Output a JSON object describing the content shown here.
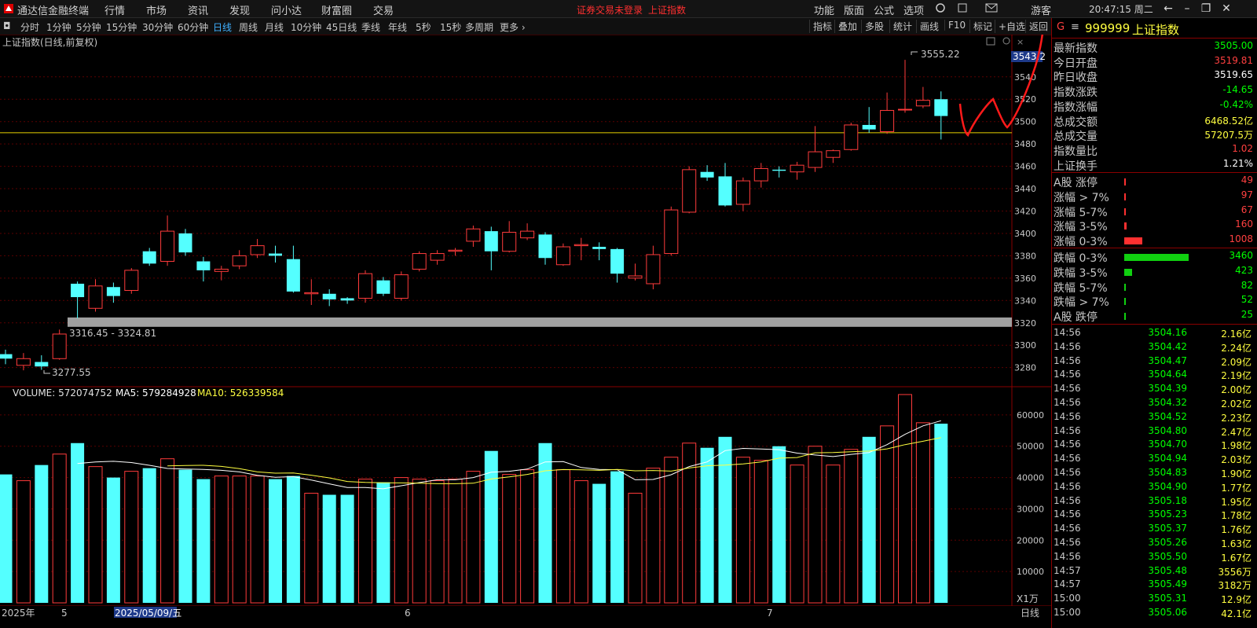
{
  "app": {
    "title": "通达信金融终端",
    "menu": [
      "行情",
      "市场",
      "资讯",
      "发现",
      "问小达",
      "财富圈",
      "交易"
    ],
    "warning": "证券交易未登录",
    "warning_symbol": "上证指数",
    "right_menu": [
      "功能",
      "版面",
      "公式",
      "选项"
    ],
    "guest": "游客",
    "clock": "20:47:15 周二"
  },
  "toolbar": {
    "periods": [
      "分时",
      "1分钟",
      "5分钟",
      "15分钟",
      "30分钟",
      "60分钟",
      "日线",
      "周线",
      "月线",
      "10分钟",
      "45日线",
      "季线",
      "年线",
      "5秒",
      "15秒",
      "多周期",
      "更多"
    ],
    "active_period": "日线",
    "tools": [
      "指标",
      "叠加",
      "多股",
      "统计",
      "画线",
      "F10",
      "标记",
      "+自选",
      "返回"
    ]
  },
  "chart_info": {
    "title": "上证指数(日线,前复权)",
    "high_label": "3555.22",
    "low_label": "3277.55",
    "range_label": "3316.45 - 3324.81",
    "cursor_price": "3543.2",
    "volume_label": "VOLUME: 572074752",
    "ma5_label": "MA5: 579284928",
    "ma10_label": "MA10: 526339584",
    "unit_label": "X1万",
    "date_labels": [
      "2025年",
      "5",
      "2025/05/09/五",
      "6",
      "7"
    ],
    "period_tag": "日线"
  },
  "chart_data": {
    "type": "candlestick",
    "ylim": [
      3265,
      3575
    ],
    "yticks": [
      3280,
      3300,
      3320,
      3340,
      3360,
      3380,
      3400,
      3420,
      3440,
      3460,
      3480,
      3500,
      3520,
      3540
    ],
    "volume_ylim": [
      0,
      68000
    ],
    "volume_yticks": [
      10000,
      20000,
      30000,
      40000,
      50000,
      60000
    ],
    "horizontal_line": 3490,
    "zone": [
      3316.45,
      3324.81
    ],
    "candles": [
      {
        "o": 3292,
        "c": 3288,
        "h": 3296,
        "l": 3283,
        "v": 41000
      },
      {
        "o": 3282,
        "c": 3288,
        "h": 3293,
        "l": 3277.55,
        "v": 39000
      },
      {
        "o": 3285,
        "c": 3281,
        "h": 3291,
        "l": 3278,
        "v": 44000
      },
      {
        "o": 3288,
        "c": 3310,
        "h": 3314,
        "l": 3287,
        "v": 47500
      },
      {
        "o": 3355,
        "c": 3343,
        "h": 3357,
        "l": 3324,
        "v": 51000
      },
      {
        "o": 3333,
        "c": 3353,
        "h": 3359,
        "l": 3330,
        "v": 43500
      },
      {
        "o": 3352,
        "c": 3344,
        "h": 3356,
        "l": 3338,
        "v": 40000
      },
      {
        "o": 3349,
        "c": 3367,
        "h": 3369,
        "l": 3346,
        "v": 42000
      },
      {
        "o": 3384,
        "c": 3373,
        "h": 3387,
        "l": 3371,
        "v": 43000
      },
      {
        "o": 3375,
        "c": 3402,
        "h": 3416,
        "l": 3371,
        "v": 46000
      },
      {
        "o": 3400,
        "c": 3383,
        "h": 3404,
        "l": 3380,
        "v": 42500
      },
      {
        "o": 3375,
        "c": 3367,
        "h": 3379,
        "l": 3357,
        "v": 39500
      },
      {
        "o": 3366,
        "c": 3368,
        "h": 3371,
        "l": 3358,
        "v": 40500
      },
      {
        "o": 3371,
        "c": 3380,
        "h": 3385,
        "l": 3368,
        "v": 40500
      },
      {
        "o": 3381,
        "c": 3389,
        "h": 3395,
        "l": 3378,
        "v": 40500
      },
      {
        "o": 3382,
        "c": 3380,
        "h": 3389,
        "l": 3374,
        "v": 39500
      },
      {
        "o": 3377,
        "c": 3348,
        "h": 3389,
        "l": 3347,
        "v": 40500
      },
      {
        "o": 3346,
        "c": 3347,
        "h": 3359,
        "l": 3336,
        "v": 35000
      },
      {
        "o": 3346,
        "c": 3341,
        "h": 3350,
        "l": 3335,
        "v": 34500
      },
      {
        "o": 3342,
        "c": 3340,
        "h": 3343,
        "l": 3337,
        "v": 34500
      },
      {
        "o": 3342,
        "c": 3364,
        "h": 3367,
        "l": 3338,
        "v": 39500
      },
      {
        "o": 3358,
        "c": 3346,
        "h": 3361,
        "l": 3344,
        "v": 38500
      },
      {
        "o": 3342,
        "c": 3363,
        "h": 3366,
        "l": 3340,
        "v": 40000
      },
      {
        "o": 3368,
        "c": 3382,
        "h": 3384,
        "l": 3366,
        "v": 39500
      },
      {
        "o": 3376,
        "c": 3382,
        "h": 3385,
        "l": 3372,
        "v": 39000
      },
      {
        "o": 3384,
        "c": 3385,
        "h": 3387,
        "l": 3380,
        "v": 39500
      },
      {
        "o": 3393,
        "c": 3404,
        "h": 3407,
        "l": 3388,
        "v": 42000
      },
      {
        "o": 3402,
        "c": 3384,
        "h": 3406,
        "l": 3367,
        "v": 48500
      },
      {
        "o": 3384,
        "c": 3401,
        "h": 3411,
        "l": 3383,
        "v": 41000
      },
      {
        "o": 3396,
        "c": 3402,
        "h": 3409,
        "l": 3394,
        "v": 42500
      },
      {
        "o": 3399,
        "c": 3378,
        "h": 3401,
        "l": 3372,
        "v": 51000
      },
      {
        "o": 3372,
        "c": 3388,
        "h": 3391,
        "l": 3371,
        "v": 42500
      },
      {
        "o": 3389,
        "c": 3390,
        "h": 3396,
        "l": 3376,
        "v": 39000
      },
      {
        "o": 3388,
        "c": 3386,
        "h": 3392,
        "l": 3376,
        "v": 38000
      },
      {
        "o": 3386,
        "c": 3364,
        "h": 3387,
        "l": 3356,
        "v": 42000
      },
      {
        "o": 3360,
        "c": 3362,
        "h": 3373,
        "l": 3358,
        "v": 35000
      },
      {
        "o": 3355,
        "c": 3381,
        "h": 3389,
        "l": 3350,
        "v": 43000
      },
      {
        "o": 3382,
        "c": 3421,
        "h": 3424,
        "l": 3380,
        "v": 46500
      },
      {
        "o": 3419,
        "c": 3457,
        "h": 3460,
        "l": 3418,
        "v": 51000
      },
      {
        "o": 3455,
        "c": 3450,
        "h": 3461,
        "l": 3447,
        "v": 49500
      },
      {
        "o": 3451,
        "c": 3425,
        "h": 3463,
        "l": 3424,
        "v": 53000
      },
      {
        "o": 3426,
        "c": 3447,
        "h": 3450,
        "l": 3420,
        "v": 46500
      },
      {
        "o": 3447,
        "c": 3458,
        "h": 3463,
        "l": 3441,
        "v": 45500
      },
      {
        "o": 3457,
        "c": 3456,
        "h": 3460,
        "l": 3450,
        "v": 50000
      },
      {
        "o": 3455,
        "c": 3461,
        "h": 3464,
        "l": 3448,
        "v": 44000
      },
      {
        "o": 3459,
        "c": 3473,
        "h": 3496,
        "l": 3455,
        "v": 50000
      },
      {
        "o": 3468,
        "c": 3474,
        "h": 3475,
        "l": 3463,
        "v": 44000
      },
      {
        "o": 3475,
        "c": 3497,
        "h": 3499,
        "l": 3474,
        "v": 49000
      },
      {
        "o": 3497,
        "c": 3493,
        "h": 3513,
        "l": 3490,
        "v": 53000
      },
      {
        "o": 3491,
        "c": 3510,
        "h": 3526,
        "l": 3489,
        "v": 56500
      },
      {
        "o": 3511,
        "c": 3511,
        "h": 3555.22,
        "l": 3508,
        "v": 66500
      },
      {
        "o": 3514,
        "c": 3519,
        "h": 3531,
        "l": 3512,
        "v": 57500
      },
      {
        "o": 3520,
        "c": 3505,
        "h": 3527,
        "l": 3484,
        "v": 57207
      }
    ],
    "legend": [
      "VOLUME",
      "MA5",
      "MA10"
    ]
  },
  "panel": {
    "code": "999999",
    "name": "上证指数",
    "stats": [
      {
        "label": "最新指数",
        "value": "3505.00",
        "color": "#00ff00"
      },
      {
        "label": "今日开盘",
        "value": "3519.81",
        "color": "#ff4040"
      },
      {
        "label": "昨日收盘",
        "value": "3519.65",
        "color": "#ffffff"
      },
      {
        "label": "指数涨跌",
        "value": "-14.65",
        "color": "#00ff00"
      },
      {
        "label": "指数涨幅",
        "value": "-0.42%",
        "color": "#00ff00"
      },
      {
        "label": "总成交额",
        "value": "6468.52亿",
        "color": "#ffff40"
      },
      {
        "label": "总成交量",
        "value": "57207.5万",
        "color": "#ffff40"
      },
      {
        "label": "指数量比",
        "value": "1.02",
        "color": "#ff4040"
      },
      {
        "label": "上证换手",
        "value": "1.21%",
        "color": "#ffffff"
      }
    ],
    "breadth_up": [
      {
        "label": "A股 涨停",
        "value": "49",
        "ratio": 0.003
      },
      {
        "label": "涨幅 > 7%",
        "value": "97",
        "ratio": 0.02
      },
      {
        "label": "涨幅 5-7%",
        "value": "67",
        "ratio": 0.01
      },
      {
        "label": "涨幅 3-5%",
        "value": "160",
        "ratio": 0.04
      },
      {
        "label": "涨幅 0-3%",
        "value": "1008",
        "ratio": 0.28
      }
    ],
    "breadth_down": [
      {
        "label": "跌幅 0-3%",
        "value": "3460",
        "ratio": 1.0
      },
      {
        "label": "跌幅 3-5%",
        "value": "423",
        "ratio": 0.12
      },
      {
        "label": "跌幅 5-7%",
        "value": "82",
        "ratio": 0.003
      },
      {
        "label": "跌幅 > 7%",
        "value": "52",
        "ratio": 0.003
      },
      {
        "label": "A股 跌停",
        "value": "25",
        "ratio": 0.003
      }
    ],
    "ticks": [
      {
        "time": "14:56",
        "price": "3504.16",
        "vol": "2.16亿"
      },
      {
        "time": "14:56",
        "price": "3504.42",
        "vol": "2.24亿"
      },
      {
        "time": "14:56",
        "price": "3504.47",
        "vol": "2.09亿"
      },
      {
        "time": "14:56",
        "price": "3504.64",
        "vol": "2.19亿"
      },
      {
        "time": "14:56",
        "price": "3504.39",
        "vol": "2.00亿"
      },
      {
        "time": "14:56",
        "price": "3504.32",
        "vol": "2.02亿"
      },
      {
        "time": "14:56",
        "price": "3504.52",
        "vol": "2.23亿"
      },
      {
        "time": "14:56",
        "price": "3504.80",
        "vol": "2.47亿"
      },
      {
        "time": "14:56",
        "price": "3504.70",
        "vol": "1.98亿"
      },
      {
        "time": "14:56",
        "price": "3504.94",
        "vol": "2.03亿"
      },
      {
        "time": "14:56",
        "price": "3504.83",
        "vol": "1.90亿"
      },
      {
        "time": "14:56",
        "price": "3504.90",
        "vol": "1.77亿"
      },
      {
        "time": "14:56",
        "price": "3505.18",
        "vol": "1.95亿"
      },
      {
        "time": "14:56",
        "price": "3505.23",
        "vol": "1.78亿"
      },
      {
        "time": "14:56",
        "price": "3505.37",
        "vol": "1.76亿"
      },
      {
        "time": "14:56",
        "price": "3505.26",
        "vol": "1.63亿"
      },
      {
        "time": "14:56",
        "price": "3505.50",
        "vol": "1.67亿"
      },
      {
        "time": "14:57",
        "price": "3505.48",
        "vol": "3556万"
      },
      {
        "time": "14:57",
        "price": "3505.49",
        "vol": "3182万"
      },
      {
        "time": "15:00",
        "price": "3505.31",
        "vol": "12.9亿"
      },
      {
        "time": "15:00",
        "price": "3505.06",
        "vol": "42.1亿"
      }
    ]
  }
}
